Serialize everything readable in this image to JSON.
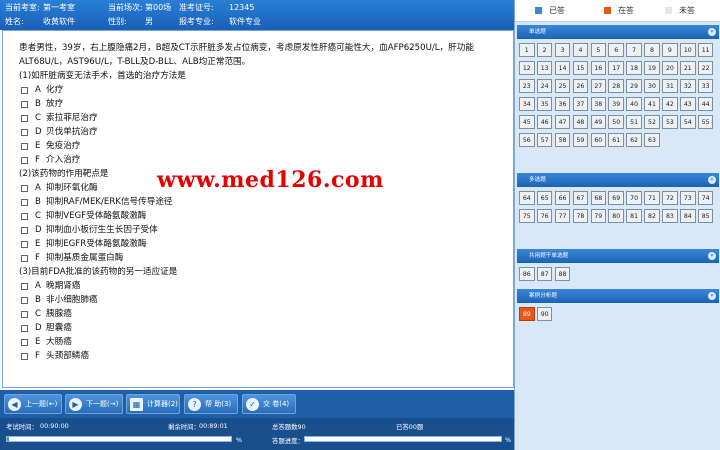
{
  "info": {
    "room_label": "当前考室:",
    "room_value": "第一考室",
    "session_label": "当前场次:",
    "session_value": "第00场",
    "cert_label": "准考证号:",
    "cert_value": "12345",
    "name_label": "姓名:",
    "name_value": "收黄软件",
    "gender_label": "性别:",
    "gender_value": "男",
    "major_label": "报考专业:",
    "major_value": "软件专业"
  },
  "question": {
    "stem": "患者男性，39岁，右上腹隐痛2月，B超及CT示肝脏多发占位病变，考虑原发性肝癌可能性大，血AFP6250U/L，肝功能ALT68U/L，AST96U/L，T-BLL及D-BLL、ALB均正常范围。",
    "subquestions": [
      {
        "title": "(1)如肝脏病变无法手术，首选的治疗方法是",
        "options": [
          {
            "letter": "A",
            "text": "化疗"
          },
          {
            "letter": "B",
            "text": "放疗"
          },
          {
            "letter": "C",
            "text": "索拉菲尼治疗"
          },
          {
            "letter": "D",
            "text": "贝伐单抗治疗"
          },
          {
            "letter": "E",
            "text": "免疫治疗"
          },
          {
            "letter": "F",
            "text": "介入治疗"
          }
        ]
      },
      {
        "title": "(2)该药物的作用靶点是",
        "options": [
          {
            "letter": "A",
            "text": "抑制环氧化酶"
          },
          {
            "letter": "B",
            "text": "抑制RAF/MEK/ERK信号传导途径"
          },
          {
            "letter": "C",
            "text": "抑制VEGF受体酪氨酸激酶"
          },
          {
            "letter": "D",
            "text": "抑制血小板衍生生长因子受体"
          },
          {
            "letter": "E",
            "text": "抑制EGFR受体酪氨酸激酶"
          },
          {
            "letter": "F",
            "text": "抑制基质金属蛋白酶"
          }
        ]
      },
      {
        "title": "(3)目前FDA批准的该药物的另一适应证是",
        "options": [
          {
            "letter": "A",
            "text": "晚期肾癌"
          },
          {
            "letter": "B",
            "text": "非小细胞肺癌"
          },
          {
            "letter": "C",
            "text": "胰腺癌"
          },
          {
            "letter": "D",
            "text": "胆囊癌"
          },
          {
            "letter": "E",
            "text": "大肠癌"
          },
          {
            "letter": "F",
            "text": "头颈部鳞癌"
          }
        ]
      }
    ]
  },
  "watermark": "www.med126.com",
  "toolbar": {
    "prev_label": "上一题(←)",
    "next_label": "下一题(→)",
    "calc_label": "计算器(2)",
    "help_label": "帮 助(3)",
    "submit_label": "交 卷(4)"
  },
  "status": {
    "exam_time_label": "考试时间：",
    "exam_time_value": "00:90:00",
    "remaining_label": "剩余时间：",
    "remaining_value": "00:89:01",
    "total_label": "总答题数90",
    "answered_label": "已答00题",
    "progress_label": "答题进度：",
    "time_progress": 0.01,
    "answer_progress": 0.0,
    "pct_symbol": "%"
  },
  "legend": {
    "answered": "已答",
    "answered_color": "#3a86d8",
    "current": "在答",
    "current_color": "#e8561b",
    "unanswered": "未答",
    "unanswered_color": "#dfe7ee"
  },
  "sections": [
    {
      "title": "单选题",
      "numbers": [
        "1",
        "2",
        "3",
        "4",
        "5",
        "6",
        "7",
        "8",
        "9",
        "10",
        "11",
        "12",
        "13",
        "14",
        "15",
        "16",
        "17",
        "18",
        "19",
        "20",
        "21",
        "22",
        "23",
        "24",
        "25",
        "26",
        "27",
        "28",
        "29",
        "30",
        "31",
        "32",
        "33",
        "34",
        "35",
        "36",
        "37",
        "38",
        "39",
        "40",
        "41",
        "42",
        "43",
        "44",
        "45",
        "46",
        "47",
        "48",
        "49",
        "50",
        "51",
        "52",
        "53",
        "54",
        "55",
        "56",
        "57",
        "58",
        "59",
        "60",
        "61",
        "62",
        "63"
      ]
    },
    {
      "title": "多选题",
      "numbers": [
        "64",
        "65",
        "66",
        "67",
        "68",
        "69",
        "70",
        "71",
        "72",
        "73",
        "74",
        "75",
        "76",
        "77",
        "78",
        "79",
        "80",
        "81",
        "82",
        "83",
        "84",
        "85"
      ]
    },
    {
      "title": "共用题干单选题",
      "numbers": [
        "86",
        "87",
        "88"
      ]
    },
    {
      "title": "案例分析题",
      "numbers": [
        "89",
        "90"
      ]
    }
  ],
  "current_question": "89",
  "collapse_glyph": "«"
}
